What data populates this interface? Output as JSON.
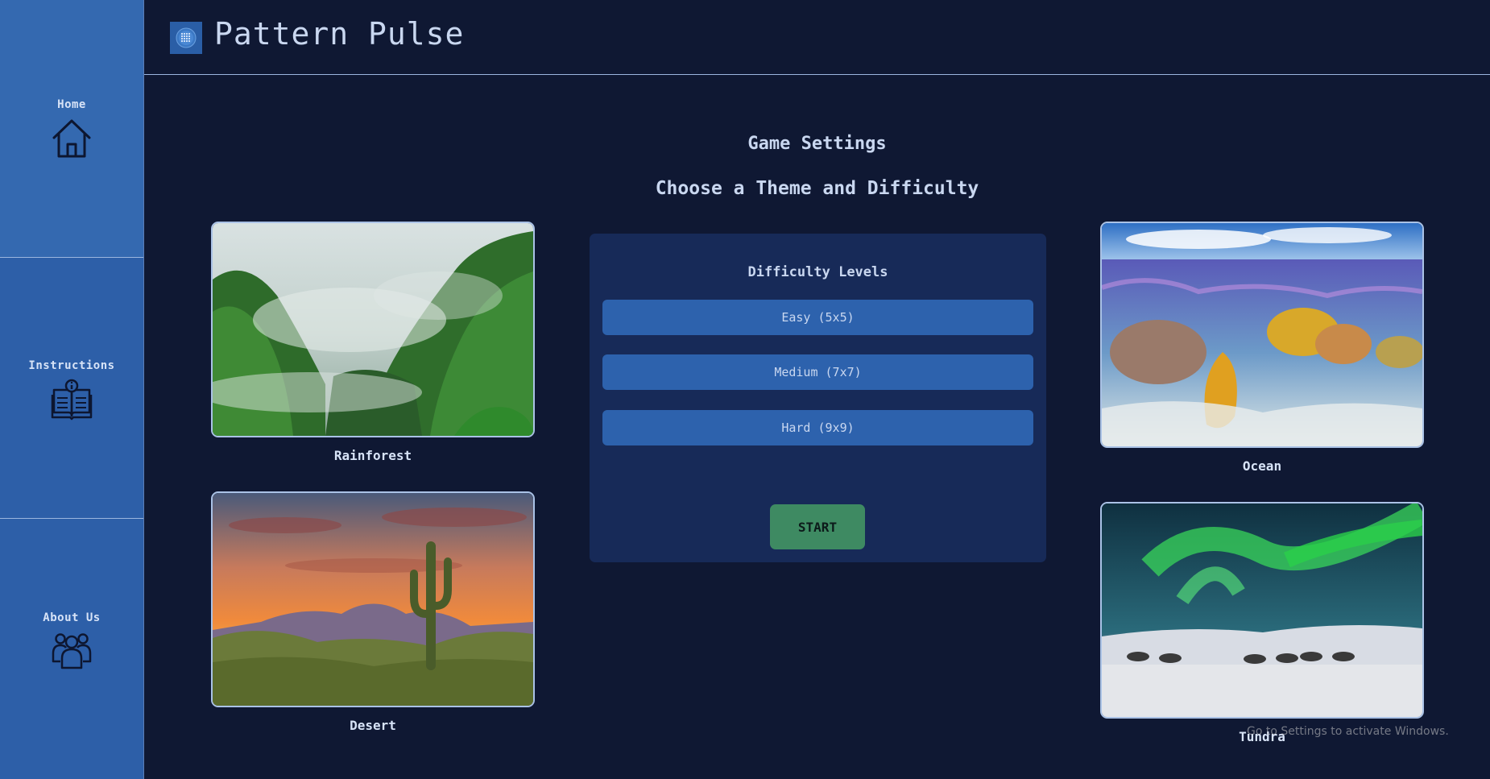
{
  "app": {
    "title": "Pattern Pulse"
  },
  "sidebar": {
    "items": [
      {
        "label": "Home",
        "icon": "home-icon"
      },
      {
        "label": "Instructions",
        "icon": "book-info-icon"
      },
      {
        "label": "About Us",
        "icon": "team-icon"
      }
    ]
  },
  "main": {
    "heading": "Game Settings",
    "subheading": "Choose a Theme and Difficulty"
  },
  "themes": [
    {
      "label": "Rainforest",
      "image": "misty-rainforest-image"
    },
    {
      "label": "Desert",
      "image": "desert-sunset-cactus-image"
    },
    {
      "label": "Ocean",
      "image": "coral-reef-ocean-image"
    },
    {
      "label": "Tundra",
      "image": "aurora-tundra-reindeer-image"
    }
  ],
  "difficulty": {
    "title": "Difficulty Levels",
    "levels": [
      "Easy (5x5)",
      "Medium (7x7)",
      "Hard (9x9)"
    ],
    "start_label": "START"
  },
  "watermark": {
    "text": "Go to Settings to activate Windows."
  },
  "colors": {
    "background": "#0f1833",
    "sidebar": "#2d5fa8",
    "panel": "#172a58",
    "button": "#2d62ad",
    "start": "#3e8a62"
  }
}
